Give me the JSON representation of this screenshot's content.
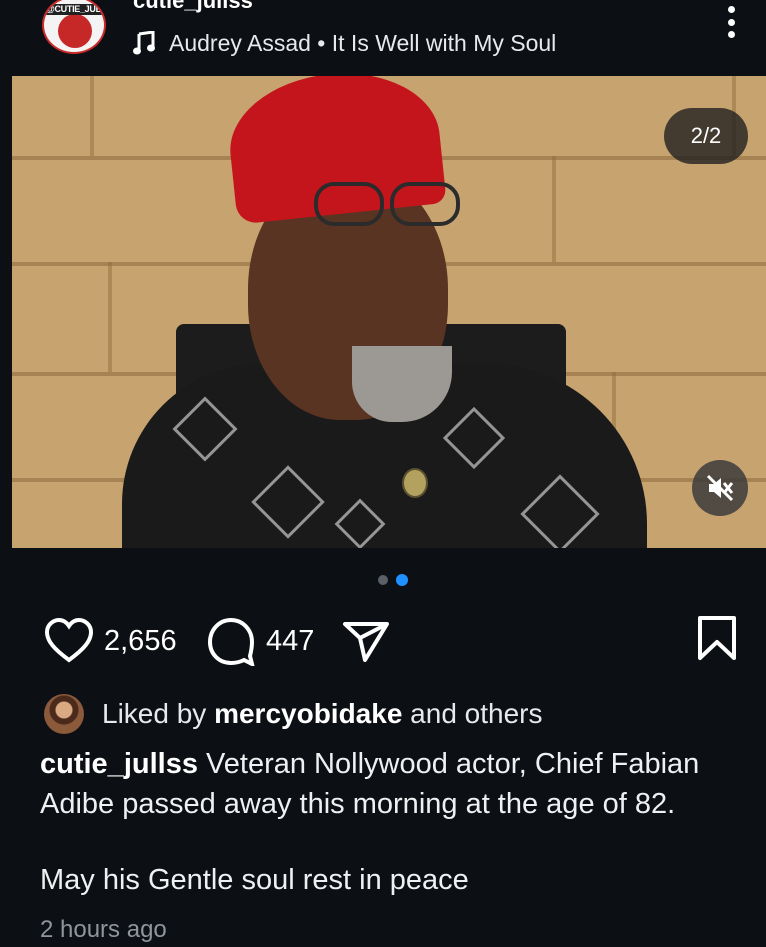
{
  "post": {
    "username": "cutie_jullss",
    "avatar_label": "@CUTIE_JULLS",
    "music": "Audrey Assad • It Is Well with My Soul",
    "image_counter": "2/2",
    "current_image": 2,
    "total_images": 2,
    "likes": "2,656",
    "comments": "447",
    "liked_by_prefix": "Liked by ",
    "liked_by_user": "mercyobidake",
    "liked_by_suffix": " and others",
    "caption_user": "cutie_jullss",
    "caption_text": " Veteran Nollywood actor, Chief Fabian Adibe passed away this morning at the age of 82.",
    "caption_extra": "May his Gentle soul rest in peace",
    "timestamp": "2 hours ago"
  },
  "colors": {
    "background": "#0c0f14",
    "accent": "#1e90ff",
    "hat": "#c4151c",
    "muted_text": "#8f959c"
  },
  "icons": [
    "music-note-icon",
    "more-icon",
    "mute-icon",
    "heart-icon",
    "comment-icon",
    "share-icon",
    "bookmark-icon"
  ]
}
